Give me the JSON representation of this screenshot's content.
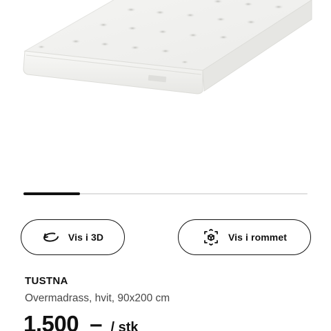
{
  "gallery": {
    "image_alt": "TUSTNA overmadrass, hvit",
    "progress_fraction": 0.2
  },
  "actions": {
    "view_3d_label": "Vis i 3D",
    "view_3d_icon": "rotate-3d-icon",
    "view_room_label": "Vis i rommet",
    "view_room_icon": "ar-cube-icon"
  },
  "product": {
    "name": "TUSTNA",
    "description": "Overmadrass, hvit, 90x200 cm",
    "price_amount": "1.500",
    "price_dash": "–",
    "price_unit": "/ stk"
  }
}
